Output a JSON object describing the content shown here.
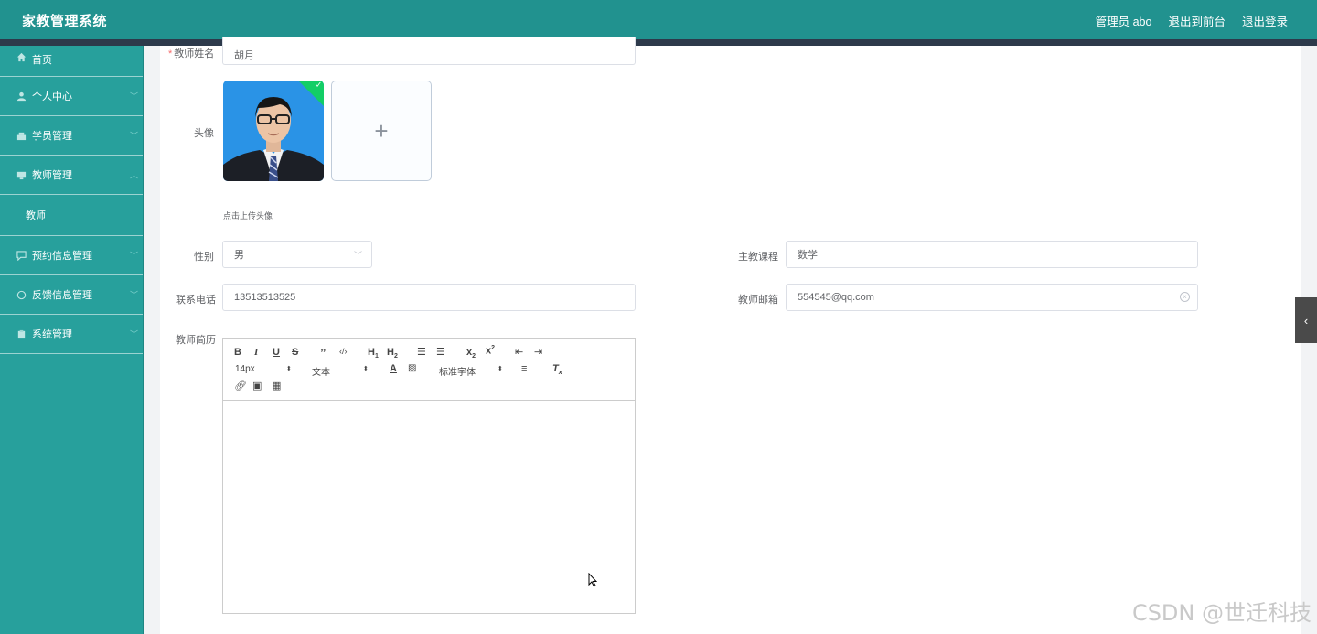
{
  "header": {
    "app_title": "家教管理系统",
    "admin_label": "管理员 abo",
    "back_to_front": "退出到前台",
    "logout": "退出登录"
  },
  "sidebar": {
    "items": [
      {
        "label": "首页",
        "icon": "home-icon"
      },
      {
        "label": "个人中心",
        "icon": "user-icon"
      },
      {
        "label": "学员管理",
        "icon": "student-icon"
      },
      {
        "label": "教师管理",
        "icon": "teacher-icon"
      },
      {
        "label": "教师",
        "icon": ""
      },
      {
        "label": "预约信息管理",
        "icon": "chat-icon"
      },
      {
        "label": "反馈信息管理",
        "icon": "feedback-icon"
      },
      {
        "label": "系统管理",
        "icon": "settings-icon"
      }
    ]
  },
  "form": {
    "name_label": "教师姓名",
    "name_required_mark": "*",
    "name_value": "胡月",
    "avatar_label": "头像",
    "upload_plus": "+",
    "upload_tip": "点击上传头像",
    "gender_label": "性别",
    "gender_value": "男",
    "course_label": "主教课程",
    "course_value": "数学",
    "phone_label": "联系电话",
    "phone_value": "13513513525",
    "email_label": "教师邮箱",
    "email_value": "554545@qq.com",
    "bio_label": "教师简历"
  },
  "editor": {
    "font_size": "14px",
    "paragraph": "文本",
    "font_family": "标准字体"
  },
  "watermark": "CSDN @世迁科技",
  "colors": {
    "header": "#21928f",
    "sidebar": "#27a09c",
    "header_stripe": "#2d3a4b",
    "success": "#13ce66"
  }
}
